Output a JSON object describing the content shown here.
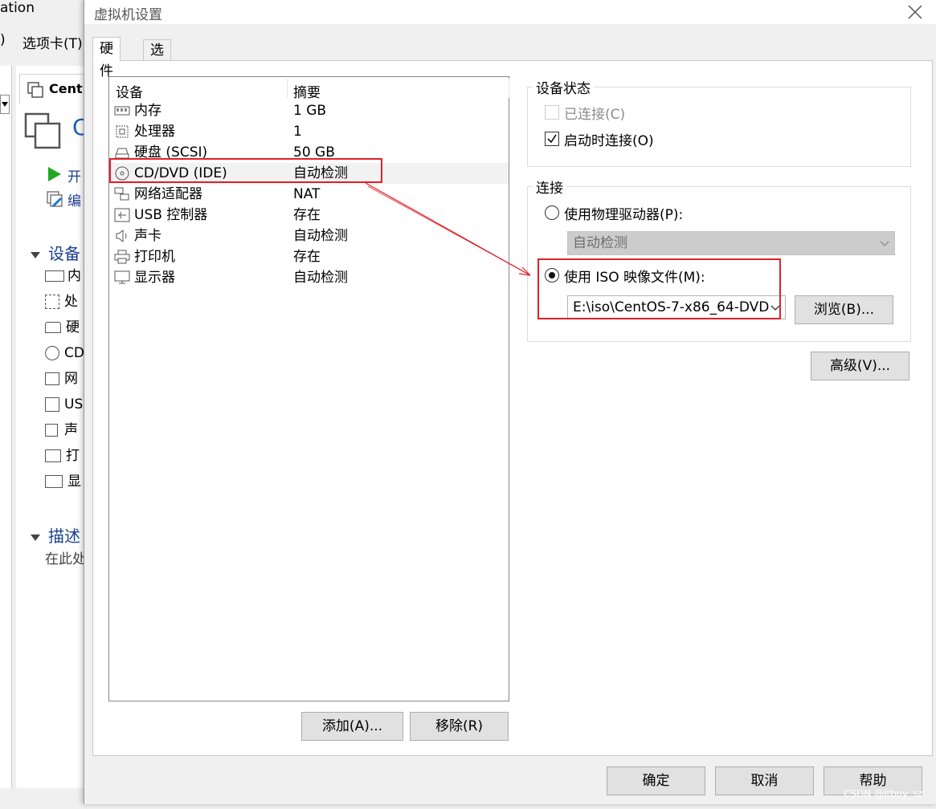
{
  "background_app": {
    "title_fragment": "ation",
    "menu_fragment_1": ")",
    "menu_tabs": "选项卡(T)",
    "vm_tab": "Cent(",
    "vm_name_fragment": "C",
    "actions": [
      "开",
      "编"
    ],
    "devices_section": "设备",
    "device_fragments": [
      "内",
      "处",
      "硬",
      "CD",
      "网",
      "US",
      "声",
      "打",
      "显"
    ],
    "description_section": "描述",
    "description_text": "在此处"
  },
  "dialog": {
    "title": "虚拟机设置",
    "close_icon": "close-icon",
    "tabs": [
      {
        "label": "硬件",
        "active": true
      },
      {
        "label": "选项",
        "active": false
      }
    ],
    "device_list": {
      "col_device": "设备",
      "col_summary": "摘要",
      "rows": [
        {
          "name": "内存",
          "summary": "1 GB",
          "icon": "memory-icon"
        },
        {
          "name": "处理器",
          "summary": "1",
          "icon": "cpu-icon"
        },
        {
          "name": "硬盘 (SCSI)",
          "summary": "50 GB",
          "icon": "harddisk-icon"
        },
        {
          "name": "CD/DVD (IDE)",
          "summary": "自动检测",
          "icon": "cd-dvd-icon",
          "selected": true
        },
        {
          "name": "网络适配器",
          "summary": "NAT",
          "icon": "network-icon"
        },
        {
          "name": "USB 控制器",
          "summary": "存在",
          "icon": "usb-icon"
        },
        {
          "name": "声卡",
          "summary": "自动检测",
          "icon": "speaker-icon"
        },
        {
          "name": "打印机",
          "summary": "存在",
          "icon": "printer-icon"
        },
        {
          "name": "显示器",
          "summary": "自动检测",
          "icon": "monitor-icon"
        }
      ]
    },
    "add_button": "添加(A)...",
    "remove_button": "移除(R)",
    "device_status": {
      "legend": "设备状态",
      "connected_label": "已连接(C)",
      "connected_checked": false,
      "connected_disabled": true,
      "connect_at_power_on_label": "启动时连接(O)",
      "connect_at_power_on_checked": true
    },
    "connection": {
      "legend": "连接",
      "physical_drive_label": "使用物理驱动器(P):",
      "physical_drive_value": "自动检测",
      "iso_label": "使用 ISO 映像文件(M):",
      "iso_selected": true,
      "iso_path": "E:\\iso\\CentOS-7-x86_64-DVD-",
      "browse_button": "浏览(B)..."
    },
    "advanced_button": "高级(V)...",
    "ok_button": "确定",
    "cancel_button": "取消",
    "help_button": "帮助"
  },
  "annotation_color": "#e0202a",
  "watermark": "CSDN @itboy_sz"
}
